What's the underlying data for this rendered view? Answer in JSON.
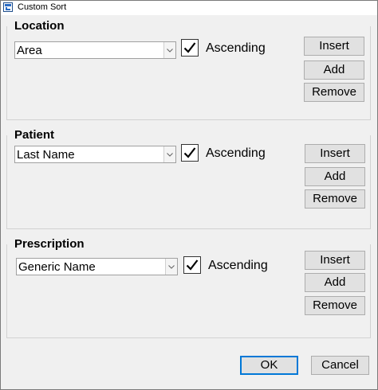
{
  "window": {
    "title": "Custom Sort",
    "icon": "sort-icon"
  },
  "groups": [
    {
      "title": "Location",
      "field": "Area",
      "ascending_checked": true,
      "ascending_label": "Ascending",
      "insert_label": "Insert",
      "add_label": "Add",
      "remove_label": "Remove"
    },
    {
      "title": "Patient",
      "field": "Last Name",
      "ascending_checked": true,
      "ascending_label": "Ascending",
      "insert_label": "Insert",
      "add_label": "Add",
      "remove_label": "Remove"
    },
    {
      "title": "Prescription",
      "field": "Generic Name",
      "ascending_checked": true,
      "ascending_label": "Ascending",
      "insert_label": "Insert",
      "add_label": "Add",
      "remove_label": "Remove"
    }
  ],
  "footer": {
    "ok_label": "OK",
    "cancel_label": "Cancel"
  },
  "colors": {
    "ok_focus_border": "#0078d7",
    "button_face": "#e1e1e1",
    "window_bg": "#f0f0f0"
  }
}
